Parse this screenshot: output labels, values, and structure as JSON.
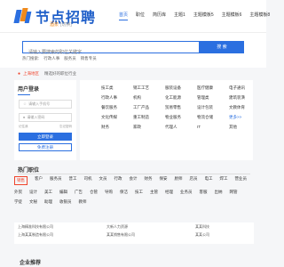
{
  "header": {
    "logo_text": "节点招聘",
    "city": "酒泉",
    "city_switch": "[切换]",
    "nav": [
      "首页",
      "职位",
      "简历库",
      "主题1",
      "主题模板5",
      "主题模板6",
      "主题模板8"
    ]
  },
  "search": {
    "placeholder": "请输入要搜索的职位关键字",
    "button": "搜 索",
    "hot_label": "热门搜索:",
    "hot_items": [
      "行政人事",
      "服务员",
      "销售专员"
    ]
  },
  "location": {
    "pin_icon": "location-pin-icon",
    "city": "上海地区",
    "text": "精选好的职位行业"
  },
  "login": {
    "title": "用户登录",
    "username_placeholder": "请输入手机号",
    "password_placeholder": "请输入密码",
    "remember": "记住我",
    "forgot": "忘记密码",
    "login_button": "立即登录",
    "register_button": "免费注册"
  },
  "categories": [
    "技工类",
    "销工工艺",
    "服装设备",
    "医疗健康",
    "电子通讯",
    "行政人事",
    "机构",
    "化工能源",
    "管理类",
    "建筑装潢",
    "餐饮服务",
    "工厂产品",
    "贸易零售",
    "设计包装",
    "文教体育",
    "文化传媒",
    "重工制造",
    "物业服务",
    "物流仓储",
    "更多>>",
    "财务",
    "家政",
    "代理人",
    "IT",
    "其他"
  ],
  "jobs_section": {
    "title": "热门职位",
    "tags": [
      "销售",
      "客户",
      "服务员",
      "普工",
      "司机",
      "文员",
      "行政",
      "会计",
      "财务",
      "保安",
      "厨师",
      "店员",
      "电工",
      "焊工",
      "营业员",
      "外贸",
      "设计",
      "美工",
      "编辑",
      "广告",
      "仓管",
      "导购",
      "保洁",
      "技工",
      "主管",
      "经理",
      "业务员",
      "客服",
      "出纳",
      "网管",
      "学徒",
      "文秘",
      "助理",
      "收银员",
      "教师"
    ],
    "active_index": 0
  },
  "companies_section": {
    "title": "名企招聘",
    "items": [
      "上海精准科技有限公司",
      "大新人力资源",
      "某某科技",
      "上海某某制造有限公司",
      "某某销售有限公司",
      "某某公司"
    ]
  },
  "bottom_section": {
    "title": "企业推荐"
  },
  "colors": {
    "primary": "#2b6fe0",
    "accent": "#f08a1c",
    "alert": "#f0442c"
  }
}
